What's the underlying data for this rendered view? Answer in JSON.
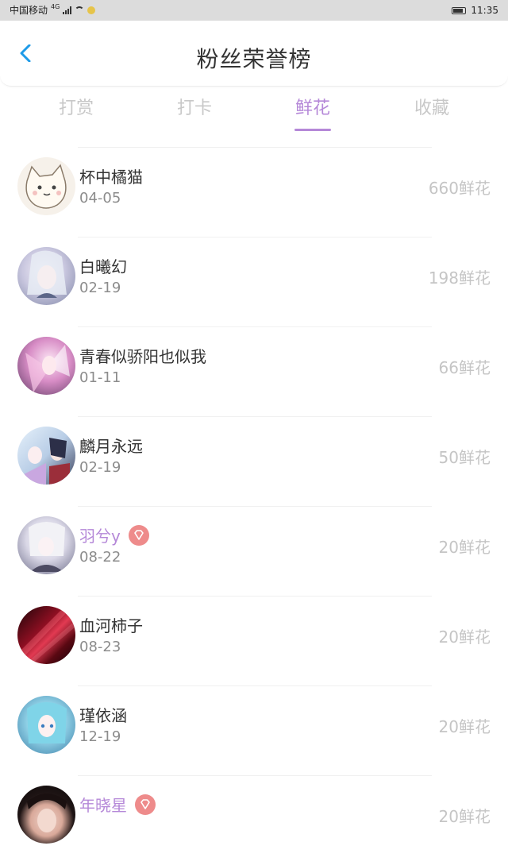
{
  "status_bar": {
    "carrier": "中国移动",
    "network": "4G",
    "time": "11:35"
  },
  "header": {
    "title": "粉丝荣誉榜",
    "back_icon": "chevron-left-icon",
    "accent_color": "#1e9be8"
  },
  "tabs": [
    {
      "label": "打赏",
      "active": false
    },
    {
      "label": "打卡",
      "active": false
    },
    {
      "label": "鲜花",
      "active": true
    },
    {
      "label": "收藏",
      "active": false
    }
  ],
  "colors": {
    "tab_active": "#b588d8",
    "tab_inactive": "#c8c8c8",
    "vip_badge": "#ee8b8b"
  },
  "fans": [
    {
      "name": "杯中橘猫",
      "date": "04-05",
      "count": "660鲜花",
      "vip": false,
      "avatar": "cat-avatar"
    },
    {
      "name": "白曦幻",
      "date": "02-19",
      "count": "198鲜花",
      "vip": false,
      "avatar": "anime-avatar"
    },
    {
      "name": "青春似骄阳也似我",
      "date": "01-11",
      "count": "66鲜花",
      "vip": false,
      "avatar": "anime-avatar"
    },
    {
      "name": "麟月永远",
      "date": "02-19",
      "count": "50鲜花",
      "vip": false,
      "avatar": "anime-avatar"
    },
    {
      "name": "羽兮y",
      "date": "08-22",
      "count": "20鲜花",
      "vip": true,
      "avatar": "anime-avatar"
    },
    {
      "name": "血河柿子",
      "date": "08-23",
      "count": "20鲜花",
      "vip": false,
      "avatar": "red-avatar"
    },
    {
      "name": "瑾依涵",
      "date": "12-19",
      "count": "20鲜花",
      "vip": false,
      "avatar": "anime-avatar"
    },
    {
      "name": "年晓星",
      "date": "",
      "count": "20鲜花",
      "vip": true,
      "avatar": "photo-avatar"
    }
  ]
}
